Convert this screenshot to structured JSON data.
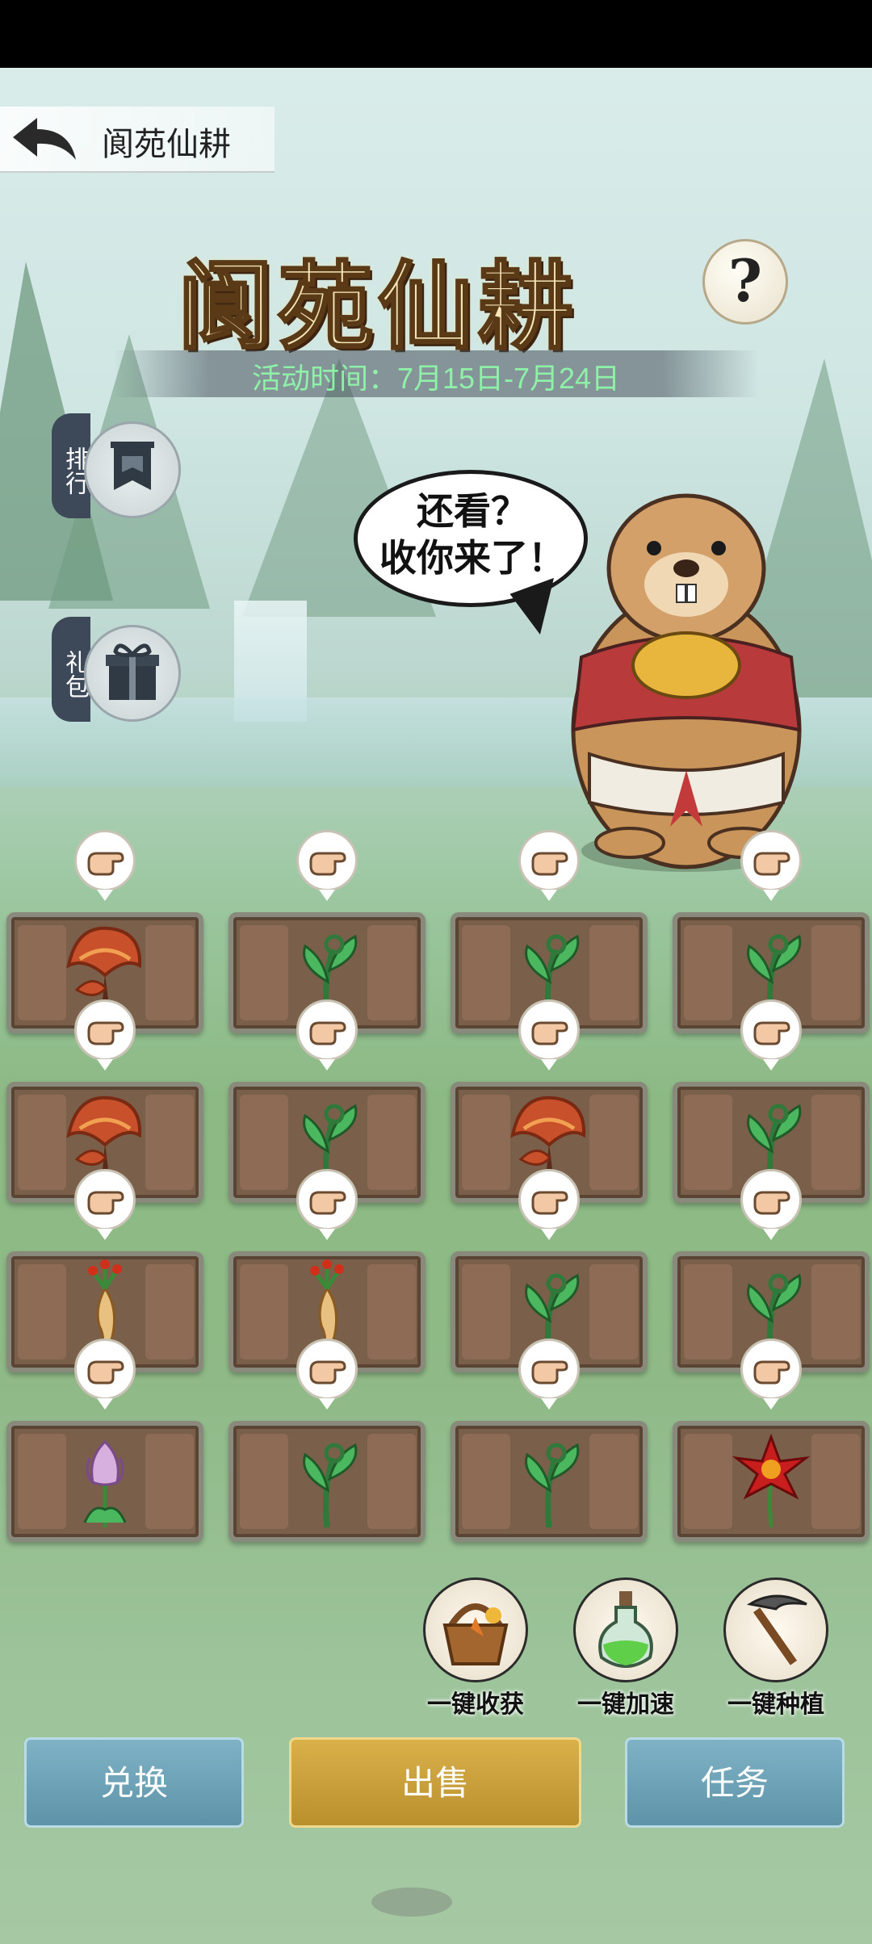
{
  "header": {
    "title": "阆苑仙耕"
  },
  "banner": {
    "title": "阆苑仙耕",
    "help": "?",
    "event_time": "活动时间：7月15日-7月24日"
  },
  "side_buttons": [
    {
      "label": "排行",
      "icon": "banner-flag-icon"
    },
    {
      "label": "礼包",
      "icon": "gift-box-icon"
    }
  ],
  "mascot": {
    "speech": "还看？\n收你来了！",
    "icon": "marmot-mascot"
  },
  "garden": {
    "harvest_hint_icon": "pointing-hand-icon",
    "plots": [
      {
        "crop": "lingzhi-mushroom"
      },
      {
        "crop": "green-sprout"
      },
      {
        "crop": "green-sprout"
      },
      {
        "crop": "green-sprout"
      },
      {
        "crop": "lingzhi-mushroom"
      },
      {
        "crop": "green-sprout"
      },
      {
        "crop": "lingzhi-mushroom"
      },
      {
        "crop": "green-sprout"
      },
      {
        "crop": "ginseng"
      },
      {
        "crop": "ginseng"
      },
      {
        "crop": "green-sprout"
      },
      {
        "crop": "green-sprout"
      },
      {
        "crop": "purple-lotus"
      },
      {
        "crop": "green-sprout"
      },
      {
        "crop": "green-sprout"
      },
      {
        "crop": "red-flower"
      }
    ]
  },
  "actions": [
    {
      "label": "一键收获",
      "icon": "basket-icon"
    },
    {
      "label": "一键加速",
      "icon": "potion-icon"
    },
    {
      "label": "一键种植",
      "icon": "pickaxe-icon"
    }
  ],
  "bottom_buttons": {
    "exchange": "兑换",
    "sell": "出售",
    "tasks": "任务"
  },
  "colors": {
    "accent_gold": "#c9a23d",
    "button_blue": "#6fa2b6",
    "event_time_green": "#8ff0a8"
  }
}
